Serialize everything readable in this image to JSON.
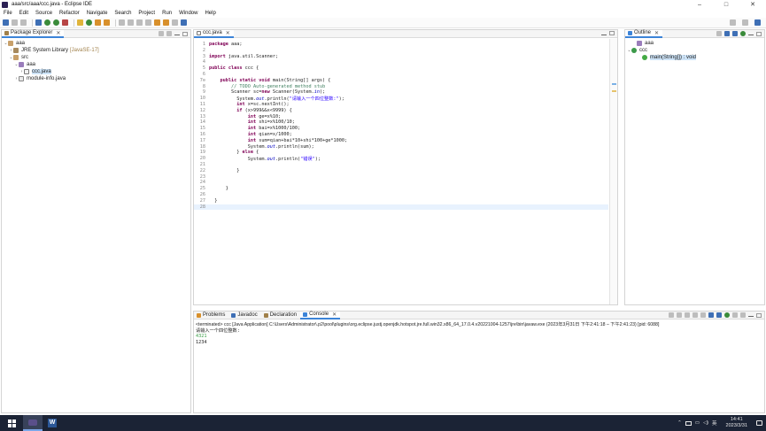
{
  "window": {
    "title": "aaa/src/aaa/ccc.java - Eclipse IDE",
    "controls": [
      "–",
      "□",
      "✕"
    ]
  },
  "menu": [
    "File",
    "Edit",
    "Source",
    "Refactor",
    "Navigate",
    "Search",
    "Project",
    "Run",
    "Window",
    "Help"
  ],
  "package_explorer": {
    "tab_label": "Package Explorer",
    "tree": [
      {
        "label": "aaa",
        "extra": "",
        "toggle": "⌄",
        "icon": "project-icon"
      },
      {
        "label": "JRE System Library",
        "extra": "[JavaSE-17]",
        "toggle": "›",
        "icon": "library-icon"
      },
      {
        "label": "src",
        "extra": "",
        "toggle": "⌄",
        "icon": "source-folder-icon"
      },
      {
        "label": "aaa",
        "extra": "",
        "toggle": "⌄",
        "icon": "package-icon"
      },
      {
        "label": "ccc.java",
        "extra": "",
        "toggle": "›",
        "icon": "java-file-icon"
      },
      {
        "label": "module-info.java",
        "extra": "",
        "toggle": "›",
        "icon": "java-file-icon"
      }
    ]
  },
  "editor": {
    "tab_label": "ccc.java",
    "lines": [
      {
        "n": "1",
        "html": "<span class=\"kw\">package</span> aaa;"
      },
      {
        "n": "2",
        "html": ""
      },
      {
        "n": "3",
        "html": "<span class=\"kw\">import</span> java.util.Scanner;"
      },
      {
        "n": "4",
        "html": ""
      },
      {
        "n": "5",
        "html": "<span class=\"kw\">public class</span> ccc {"
      },
      {
        "n": "6",
        "html": ""
      },
      {
        "n": "7⊖",
        "html": "    <span class=\"kw\">public static void</span> main(String[] args) {"
      },
      {
        "n": "8",
        "html": "        <span class=\"cm\">// TODO Auto-generated method stub</span>"
      },
      {
        "n": "9",
        "html": "        Scanner sc=<span class=\"kw\">new</span> Scanner(System.<span class=\"fd\">in</span>);"
      },
      {
        "n": "10",
        "html": "          System.<span class=\"fd\">out</span>.println(<span class=\"st\">\"请输入一个四位整数:\"</span>);"
      },
      {
        "n": "11",
        "html": "          <span class=\"kw\">int</span> x=sc.nextInt();"
      },
      {
        "n": "12",
        "html": "          <span class=\"kw\">if</span> (x>999&&x<9999) {"
      },
      {
        "n": "13",
        "html": "              <span class=\"kw\">int</span> ge=x%10;"
      },
      {
        "n": "14",
        "html": "              <span class=\"kw\">int</span> shi=x%100/10;"
      },
      {
        "n": "15",
        "html": "              <span class=\"kw\">int</span> bai=x%1000/100;"
      },
      {
        "n": "16",
        "html": "              <span class=\"kw\">int</span> qian=x/1000;"
      },
      {
        "n": "17",
        "html": "              <span class=\"kw\">int</span> sum=qian+bai*10+shi*100+ge*1000;"
      },
      {
        "n": "18",
        "html": "              System.<span class=\"fd\">out</span>.println(sum);"
      },
      {
        "n": "19",
        "html": "          } <span class=\"kw\">else</span> {"
      },
      {
        "n": "20",
        "html": "              System.<span class=\"fd\">out</span>.println(<span class=\"st\">\"错误\"</span>);"
      },
      {
        "n": "21",
        "html": ""
      },
      {
        "n": "22",
        "html": "          }"
      },
      {
        "n": "23",
        "html": ""
      },
      {
        "n": "24",
        "html": ""
      },
      {
        "n": "25",
        "html": "      }"
      },
      {
        "n": "26",
        "html": ""
      },
      {
        "n": "27",
        "html": "  }"
      },
      {
        "n": "28",
        "html": ""
      }
    ]
  },
  "outline": {
    "tab_label": "Outline",
    "tree": [
      {
        "label": "aaa",
        "toggle": "",
        "icon": "package-icon"
      },
      {
        "label": "ccc",
        "toggle": "⌄",
        "icon": "class-icon"
      },
      {
        "label": "main(String[]) : void",
        "toggle": "",
        "icon": "method-icon"
      }
    ]
  },
  "bottom": {
    "tabs": [
      "Problems",
      "Javadoc",
      "Declaration",
      "Console"
    ],
    "console_header": "<terminated> ccc [Java Application] C:\\Users\\Administrator\\.p2\\pool\\plugins\\org.eclipse.justj.openjdk.hotspot.jre.full.win32.x86_64_17.0.4.v20221004-1257\\jre\\bin\\javaw.exe  (2023年3月31日 下午2:41:18 – 下午2:41:23) [pid: 6088]",
    "console_lines": [
      {
        "text": "请输入一个四位整数:",
        "color": "#222222"
      },
      {
        "text": "4321",
        "color": "#3ca04a"
      },
      {
        "text": "1234",
        "color": "#222222"
      }
    ]
  },
  "taskbar": {
    "time": "14:41",
    "date": "2023/3/31",
    "ime": "英"
  },
  "colors": {
    "accent": "#3c84d8",
    "taskbar": "#1b2335"
  }
}
